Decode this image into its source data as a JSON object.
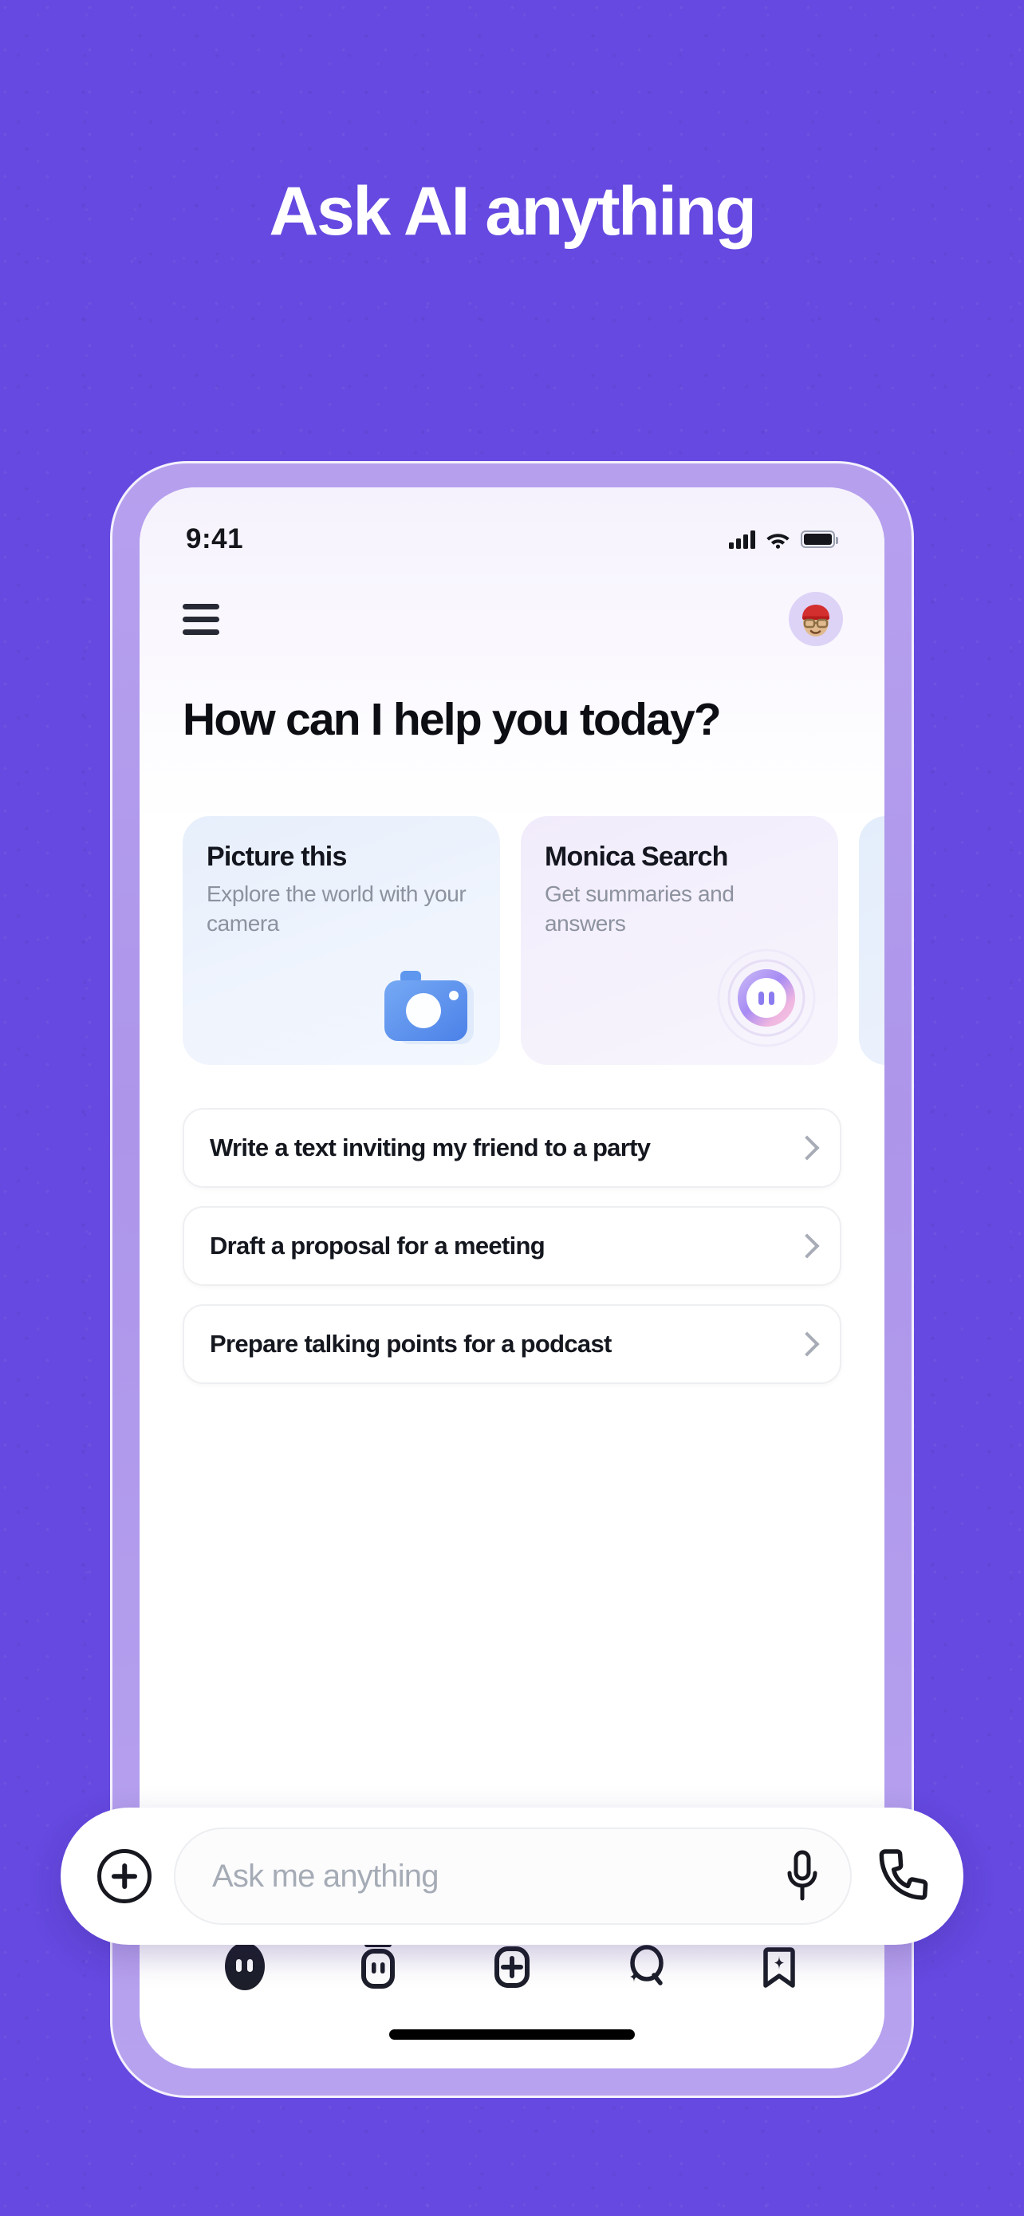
{
  "hero": {
    "headline": "Ask AI anything"
  },
  "theme": {
    "background": "#6549E0",
    "bezel": "#AD96EA",
    "card_blue": "#E7EFFC",
    "card_lilac": "#F1ECFB",
    "text_primary": "#14161F",
    "text_muted": "#8C929F"
  },
  "phone": {
    "status_bar": {
      "time": "9:41",
      "signal_icon": "cellular-bars-icon",
      "wifi_icon": "wifi-icon",
      "battery_icon": "battery-full-icon"
    },
    "header": {
      "menu_icon": "hamburger-menu-icon",
      "avatar_icon": "user-avatar-icon"
    },
    "page_title": "How can I help you today?",
    "cards": [
      {
        "title": "Picture this",
        "subtitle": "Explore the world with your camera",
        "icon": "camera-icon",
        "style": "blue"
      },
      {
        "title": "Monica Search",
        "subtitle": "Get summaries and answers",
        "icon": "monica-face-icon",
        "style": "lilac"
      },
      {
        "title": "",
        "subtitle": "",
        "icon": "",
        "style": "blue2"
      }
    ],
    "suggestions": [
      {
        "label": "Write a text inviting my friend to a party",
        "chevron": "chevron-right-icon"
      },
      {
        "label": "Draft a proposal for a meeting",
        "chevron": "chevron-right-icon"
      },
      {
        "label": "Prepare talking points for a podcast",
        "chevron": "chevron-right-icon"
      }
    ],
    "input_bar": {
      "add_icon": "plus-circle-icon",
      "placeholder": "Ask me anything",
      "value": "",
      "mic_icon": "microphone-icon",
      "call_icon": "phone-call-icon"
    },
    "bottom_nav": [
      {
        "icon": "monica-face-icon",
        "active": true
      },
      {
        "icon": "bot-icon",
        "active": false
      },
      {
        "icon": "plus-square-icon",
        "active": false
      },
      {
        "icon": "search-sparkle-icon",
        "active": false
      },
      {
        "icon": "bookmark-sparkle-icon",
        "active": false
      }
    ],
    "home_indicator": "home-indicator"
  }
}
